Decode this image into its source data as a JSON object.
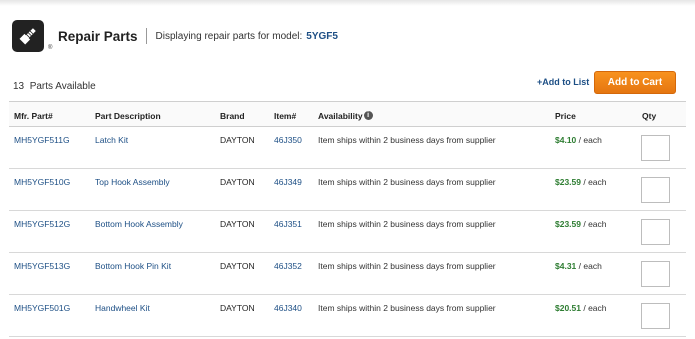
{
  "header": {
    "title": "Repair Parts",
    "subtitle": "Displaying repair parts for model:",
    "model": "5YGF5",
    "logo_mark": "®"
  },
  "summary": {
    "count": "13",
    "count_label": "Parts Available",
    "add_to_list": "+Add to List",
    "add_to_cart": "Add to Cart"
  },
  "columns": {
    "mfr": "Mfr. Part#",
    "desc": "Part Description",
    "brand": "Brand",
    "item": "Item#",
    "availability": "Availability",
    "price": "Price",
    "qty": "Qty"
  },
  "rows": [
    {
      "mfr": "MH5YGF511G",
      "desc": "Latch Kit",
      "brand": "DAYTON",
      "item": "46J350",
      "avail": "Item ships within 2 business days from supplier",
      "price": "$4.10",
      "unit": " / each"
    },
    {
      "mfr": "MH5YGF510G",
      "desc": "Top Hook Assembly",
      "brand": "DAYTON",
      "item": "46J349",
      "avail": "Item ships within 2 business days from supplier",
      "price": "$23.59",
      "unit": " / each"
    },
    {
      "mfr": "MH5YGF512G",
      "desc": "Bottom Hook Assembly",
      "brand": "DAYTON",
      "item": "46J351",
      "avail": "Item ships within 2 business days from supplier",
      "price": "$23.59",
      "unit": " / each"
    },
    {
      "mfr": "MH5YGF513G",
      "desc": "Bottom Hook Pin Kit",
      "brand": "DAYTON",
      "item": "46J352",
      "avail": "Item ships within 2 business days from supplier",
      "price": "$4.31",
      "unit": " / each"
    },
    {
      "mfr": "MH5YGF501G",
      "desc": "Handwheel Kit",
      "brand": "DAYTON",
      "item": "46J340",
      "avail": "Item ships within 2 business days from supplier",
      "price": "$20.51",
      "unit": " / each"
    }
  ],
  "colors": {
    "link": "#1d4f85",
    "price": "#2e7d32",
    "cart_button": "#f08a1c"
  },
  "icons": {
    "logo": "bolt-wrench-icon",
    "info": "info-icon"
  }
}
